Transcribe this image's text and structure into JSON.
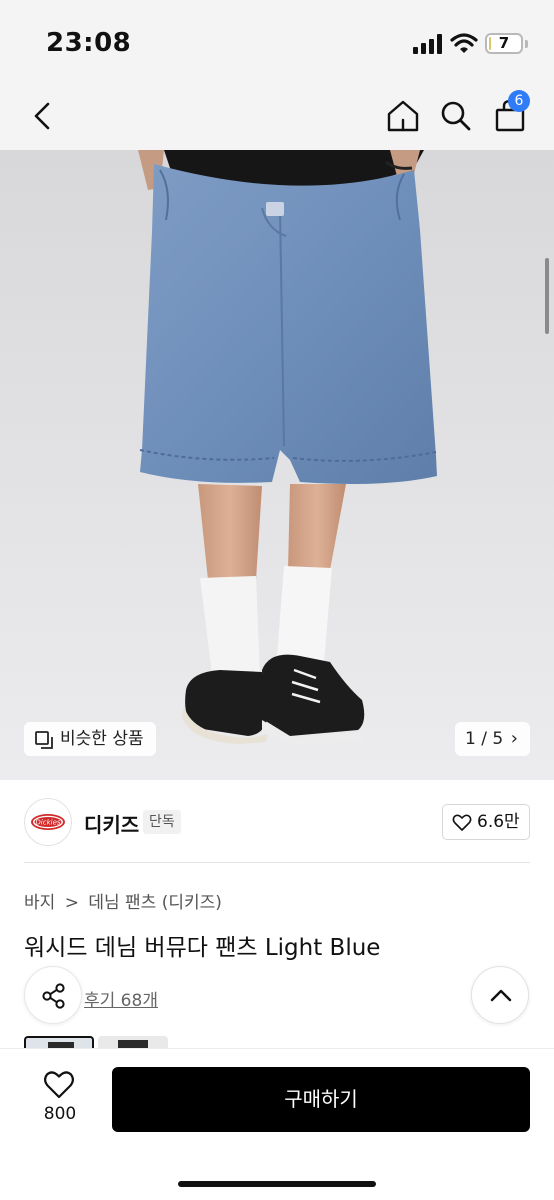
{
  "status_bar": {
    "time": "23:08",
    "battery_level": "7",
    "battery_percent": 0.07,
    "icons": [
      "signal-icon",
      "wifi-icon",
      "battery-icon"
    ]
  },
  "nav": {
    "icons": [
      "back-icon",
      "home-icon",
      "search-icon",
      "bag-icon"
    ],
    "cart_badge": "6",
    "accent_color": "#2f7cf6"
  },
  "gallery": {
    "similar_label": "비슷한 상품",
    "pager": "1 / 5",
    "pager_arrow": "›"
  },
  "brand": {
    "logo_text": "Dickies",
    "name": "디키즈",
    "tag": "단독",
    "like_count": "6.6만"
  },
  "product": {
    "breadcrumb": [
      "바지",
      ">",
      "데님 팬츠 (디키즈)"
    ],
    "title": "워시드 데님 버뮤다 팬츠 Light Blue",
    "review_link": "후기 68개"
  },
  "bottom_bar": {
    "wish_count": "800",
    "buy_label": "구매하기",
    "button_color": "#000000"
  }
}
